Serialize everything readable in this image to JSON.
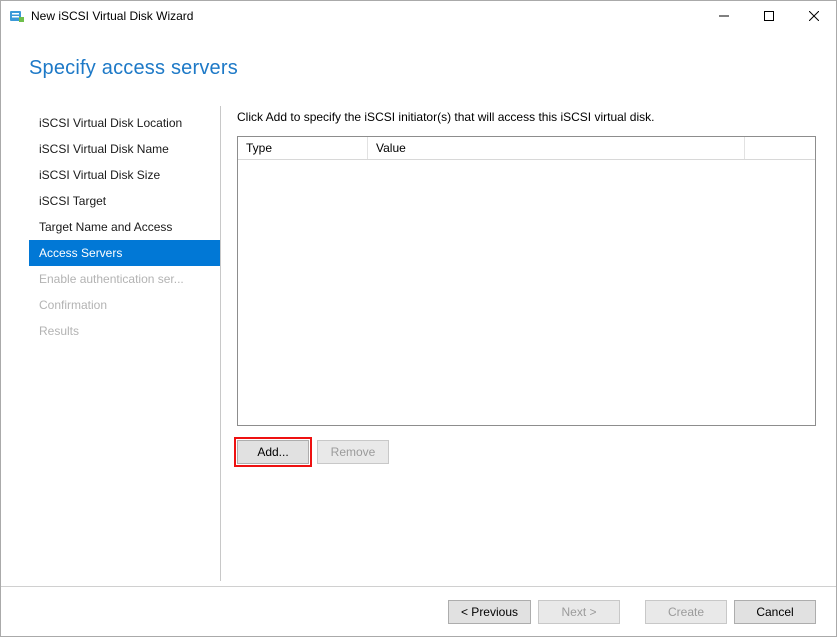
{
  "window": {
    "title": "New iSCSI Virtual Disk Wizard"
  },
  "heading": "Specify access servers",
  "steps": [
    {
      "label": "iSCSI Virtual Disk Location",
      "state": "normal"
    },
    {
      "label": "iSCSI Virtual Disk Name",
      "state": "normal"
    },
    {
      "label": "iSCSI Virtual Disk Size",
      "state": "normal"
    },
    {
      "label": "iSCSI Target",
      "state": "normal"
    },
    {
      "label": "Target Name and Access",
      "state": "normal"
    },
    {
      "label": "Access Servers",
      "state": "selected"
    },
    {
      "label": "Enable authentication ser...",
      "state": "disabled"
    },
    {
      "label": "Confirmation",
      "state": "disabled"
    },
    {
      "label": "Results",
      "state": "disabled"
    }
  ],
  "instruction": "Click Add to specify the iSCSI initiator(s) that will access this iSCSI virtual disk.",
  "columns": {
    "type": "Type",
    "value": "Value"
  },
  "buttons": {
    "add": "Add...",
    "remove": "Remove",
    "previous": "< Previous",
    "next": "Next >",
    "create": "Create",
    "cancel": "Cancel"
  }
}
